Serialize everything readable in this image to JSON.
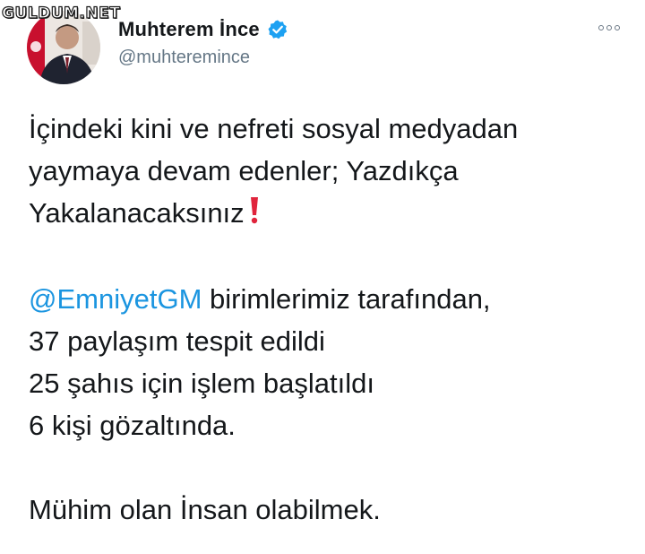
{
  "watermark": "GULDUM.NET",
  "author": {
    "display_name": "Muhterem İnce",
    "handle": "@muhteremince",
    "verified_icon": "verified-badge-icon",
    "accent_color": "#1da1f2"
  },
  "more_icon": "more-options-icon",
  "tweet": {
    "line1": "İçindeki kini ve nefreti sosyal medyadan",
    "line2": "yaymaya devam edenler; Yazdıkça",
    "line3": "Yakalanacaksınız",
    "exclaim_icon": "red-exclamation-icon",
    "mention": "@EmniyetGM",
    "line4_rest": " birimlerimiz tarafından,",
    "line5": "37 paylaşım tespit edildi",
    "line6": "25 şahıs için işlem başlatıldı",
    "line7": "6 kişi gözaltında.",
    "line8": "Mühim olan İnsan olabilmek.",
    "mention_color": "#1b95e0",
    "exclaim_color": "#e0243c"
  }
}
